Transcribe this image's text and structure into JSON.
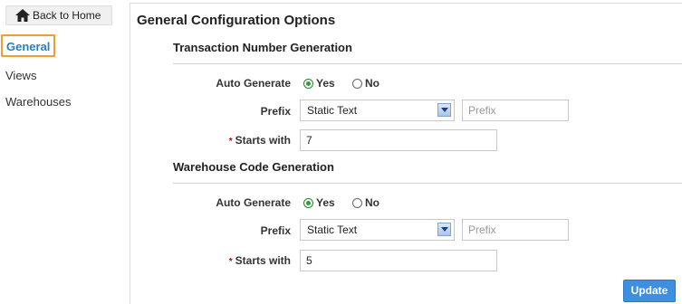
{
  "sidebar": {
    "back_label": "Back to Home",
    "items": [
      {
        "label": "General"
      },
      {
        "label": "Views"
      },
      {
        "label": "Warehouses"
      }
    ]
  },
  "main": {
    "title": "General Configuration Options",
    "sections": [
      {
        "title": "Transaction Number Generation",
        "auto_generate_label": "Auto Generate",
        "yes_label": "Yes",
        "no_label": "No",
        "auto_generate_value": "Yes",
        "prefix_label": "Prefix",
        "prefix_type": "Static Text",
        "prefix_placeholder": "Prefix",
        "starts_with_label": "Starts with",
        "starts_with_value": "7"
      },
      {
        "title": "Warehouse Code Generation",
        "auto_generate_label": "Auto Generate",
        "yes_label": "Yes",
        "no_label": "No",
        "auto_generate_value": "Yes",
        "prefix_label": "Prefix",
        "prefix_type": "Static Text",
        "prefix_placeholder": "Prefix",
        "starts_with_label": "Starts with",
        "starts_with_value": "5"
      }
    ],
    "update_label": "Update",
    "required_marker": "*"
  },
  "colors": {
    "accent": "#3e8fe0",
    "active_nav_border": "#f0a030",
    "active_nav_text": "#2a7fc0"
  }
}
